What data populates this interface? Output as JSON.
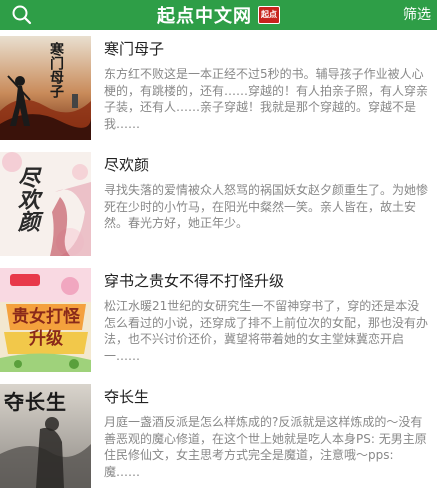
{
  "header": {
    "title": "起点中文网",
    "badge": "起点",
    "filter_label": "筛选",
    "search_icon": "search-icon",
    "bg_color": "#2e9e47"
  },
  "books": [
    {
      "title": "寒门母子",
      "cover_text": "寒门母子",
      "description": "东方红不败这是一本正经不过5秒的书。辅导孩子作业被人心梗的，有跳楼的，还有……穿越的！有人拍亲子照，有人穿亲子装，还有人……亲子穿越！我就是那个穿越的。穿越不是我……"
    },
    {
      "title": "尽欢颜",
      "cover_text": "尽欢颜",
      "description": "寻找失落的爱情被众人怒骂的祸国妖女赵夕颜重生了。为她惨死在少时的小竹马，在阳光中粲然一笑。亲人皆在，故土安然。春光方好，她正年少。"
    },
    {
      "title": "穿书之贵女不得不打怪升级",
      "cover_text": "贵女打怪升级",
      "description": "松江水暖21世纪的女研究生一不留神穿书了，穿的还是本没怎么看过的小说，还穿成了排不上前位次的女配，那也没有办法，也不兴讨价还价，冀望将带着她的女主堂妹冀恋开启一……"
    },
    {
      "title": "夺长生",
      "cover_text": "夺长生",
      "description": "月庭一盏酒反派是怎么样炼成的?反派就是这样炼成的～没有善恶观的魔心修道，在这个世上她就是吃人本身PS: 无男主原住民修仙文，女主思考方式完全是魔道，注意哦～pps: 魔……"
    }
  ]
}
